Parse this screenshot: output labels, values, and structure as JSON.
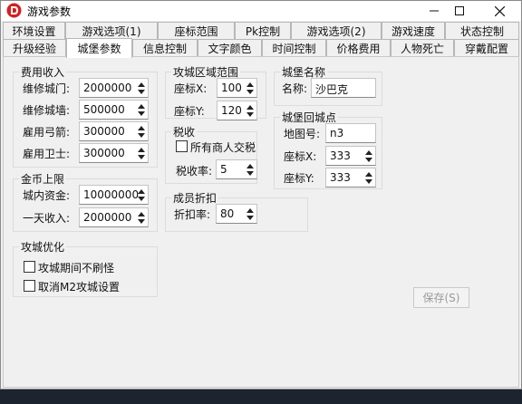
{
  "window": {
    "title": "游戏参数",
    "colors": {
      "titlebar": "#ffffff",
      "body": "#f0f0f0",
      "icon": "#d42020"
    }
  },
  "tabs_row1": [
    {
      "label": "环境设置"
    },
    {
      "label": "游戏选项(1)"
    },
    {
      "label": "座标范围"
    },
    {
      "label": "Pk控制"
    },
    {
      "label": "游戏选项(2)"
    },
    {
      "label": "游戏速度"
    },
    {
      "label": "状态控制"
    }
  ],
  "tabs_row2": [
    {
      "label": "升级经验"
    },
    {
      "label": "城堡参数",
      "active": true
    },
    {
      "label": "信息控制"
    },
    {
      "label": "文字颜色"
    },
    {
      "label": "时间控制"
    },
    {
      "label": "价格费用"
    },
    {
      "label": "人物死亡"
    },
    {
      "label": "穿戴配置"
    }
  ],
  "fee_income": {
    "title": "费用收入",
    "gate_label": "维修城门:",
    "gate_value": "2000000",
    "wall_label": "维修城墙:",
    "wall_value": "500000",
    "archer_label": "雇用弓箭:",
    "archer_value": "300000",
    "guard_label": "雇用卫士:",
    "guard_value": "300000"
  },
  "gold_limit": {
    "title": "金币上限",
    "castle_funds_label": "城内资金:",
    "castle_funds_value": "10000000",
    "daily_income_label": "一天收入:",
    "daily_income_value": "2000000"
  },
  "siege_optimize": {
    "title": "攻城优化",
    "no_refresh_label": "攻城期间不刷怪",
    "no_refresh_checked": false,
    "cancel_m2_label": "取消M2攻城设置",
    "cancel_m2_checked": false
  },
  "siege_area": {
    "title": "攻城区域范围",
    "x_label": "座标X:",
    "x_value": "100",
    "y_label": "座标Y:",
    "y_value": "120"
  },
  "tax": {
    "title": "税收",
    "all_merchants_label": "所有商人交税",
    "all_merchants_checked": false,
    "rate_label": "税收率:",
    "rate_value": "5"
  },
  "member_discount": {
    "title": "成员折扣",
    "rate_label": "折扣率:",
    "rate_value": "80"
  },
  "castle_name": {
    "title": "城堡名称",
    "name_label": "名称:",
    "name_value": "沙巴克"
  },
  "castle_return": {
    "title": "城堡回城点",
    "map_label": "地图号:",
    "map_value": "n3",
    "x_label": "座标X:",
    "x_value": "333",
    "y_label": "座标Y:",
    "y_value": "333"
  },
  "save_button": {
    "label": "保存(S)",
    "enabled": false
  }
}
